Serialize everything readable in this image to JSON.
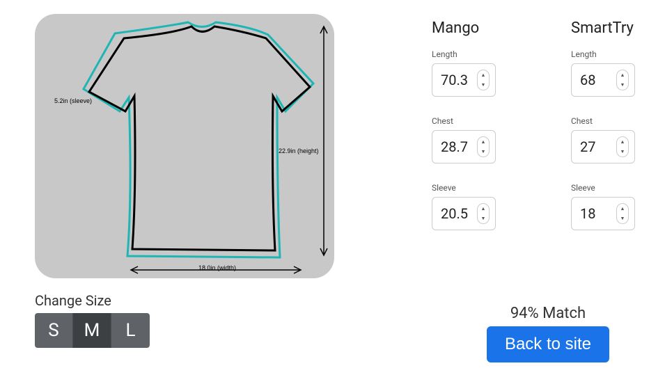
{
  "diagram": {
    "sleeve_label": "5.2in (sleeve)",
    "height_label": "22.9in (height)",
    "width_label": "18.0in (width)"
  },
  "change_size": {
    "title": "Change Size",
    "sizes": [
      "S",
      "M",
      "L"
    ],
    "active": "M"
  },
  "columns": [
    {
      "brand": "Mango",
      "measurements": [
        {
          "label": "Length",
          "value": "70.3"
        },
        {
          "label": "Chest",
          "value": "28.7"
        },
        {
          "label": "Sleeve",
          "value": "20.5"
        }
      ]
    },
    {
      "brand": "SmartTry",
      "measurements": [
        {
          "label": "Length",
          "value": "68"
        },
        {
          "label": "Chest",
          "value": "27"
        },
        {
          "label": "Sleeve",
          "value": "18"
        }
      ]
    }
  ],
  "match_text": "94% Match",
  "back_label": "Back to site"
}
